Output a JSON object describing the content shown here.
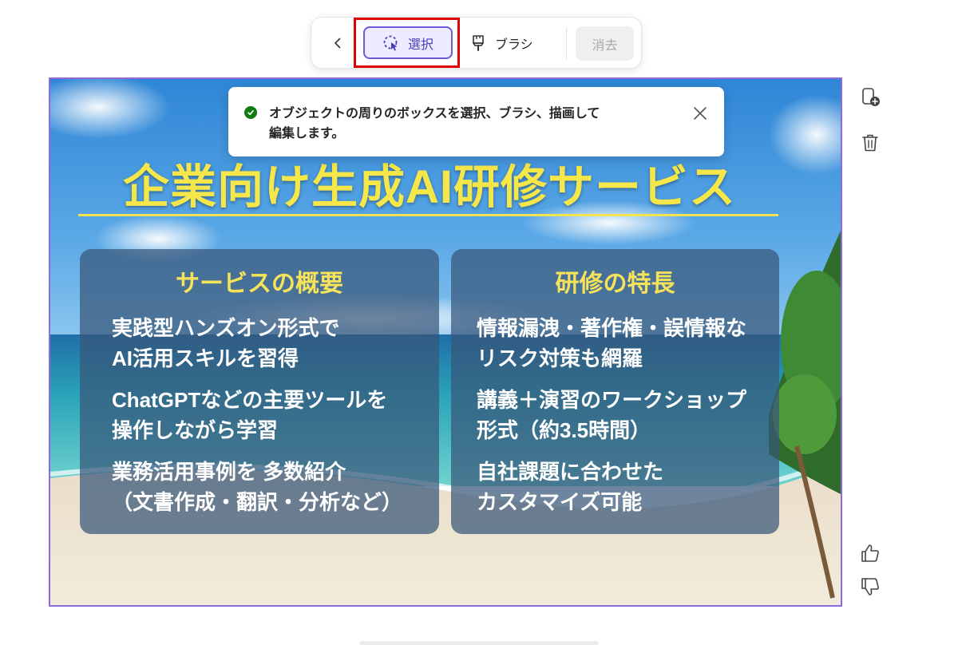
{
  "toolbar": {
    "select_label": "選択",
    "brush_label": "ブラシ",
    "erase_label": "消去"
  },
  "toast": {
    "message_line1": "オブジェクトの周りのボックスを選択、ブラシ、描画して",
    "message_line2": "編集します。"
  },
  "slide": {
    "title": "企業向け生成AI研修サービス",
    "left_card": {
      "heading": "サービスの概要",
      "items": [
        {
          "line1": "実践型ハンズオン形式で",
          "line2": "AI活用スキルを習得"
        },
        {
          "line1": "ChatGPTなどの主要ツールを",
          "line2": "操作しながら学習"
        },
        {
          "line1": "業務活用事例を 多数紹介",
          "line2": "（文書作成・翻訳・分析など）"
        }
      ]
    },
    "right_card": {
      "heading": "研修の特長",
      "items": [
        {
          "line1": "情報漏洩・著作権・誤情報な",
          "line2": "リスク対策も網羅"
        },
        {
          "line1": "講義＋演習のワークショップ",
          "line2": "形式（約3.5時間）"
        },
        {
          "line1": "自社課題に合わせた",
          "line2": "カスタマイズ可能"
        }
      ]
    }
  },
  "icons": {
    "back": "chevron-left-icon",
    "select": "lasso-select-icon",
    "brush": "brush-icon",
    "toast_status": "check-circle-icon",
    "toast_close": "close-icon",
    "side": [
      "new-slide-icon",
      "trash-icon",
      "thumbs-up-icon",
      "thumbs-down-icon"
    ]
  },
  "colors": {
    "accent": "#6b5bd6",
    "highlight_box": "#e00000",
    "title_yellow": "#f5e64a",
    "success": "#107c10"
  }
}
